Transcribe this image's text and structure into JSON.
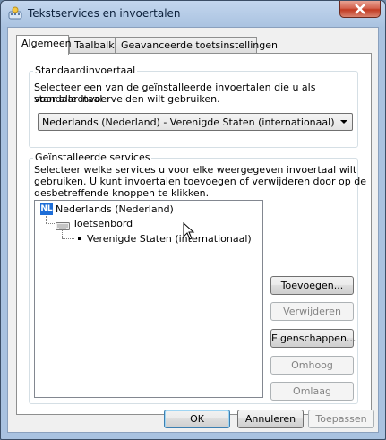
{
  "window": {
    "title": "Tekstservices en invoertalen"
  },
  "tabs": [
    {
      "label": "Algemeen",
      "active": true
    },
    {
      "label": "Taalbalk",
      "active": false
    },
    {
      "label": "Geavanceerde toetsinstellingen",
      "active": false
    }
  ],
  "default_language": {
    "group_label": "Standaardinvoertaal",
    "description_line1": "Selecteer een van de geïnstalleerde invoertalen die u als standaardtaal",
    "description_line2": "voor alle invoervelden wilt gebruiken.",
    "selected": "Nederlands (Nederland) - Verenigde Staten (internationaal)"
  },
  "installed_services": {
    "group_label": "Geïnstalleerde services",
    "description_line1": "Selecteer welke services u voor elke weergegeven invoertaal wilt",
    "description_line2": "gebruiken. U kunt invoertalen toevoegen of verwijderen door op de",
    "description_line3": "desbetreffende knoppen te klikken.",
    "tree": {
      "language_badge": "NL",
      "language": "Nederlands (Nederland)",
      "category": "Toetsenbord",
      "layout": "Verenigde Staten (internationaal)"
    }
  },
  "side_buttons": {
    "add": "Toevoegen...",
    "remove": "Verwijderen",
    "properties": "Eigenschappen...",
    "up": "Omhoog",
    "down": "Omlaag"
  },
  "footer": {
    "ok": "OK",
    "cancel": "Annuleren",
    "apply": "Toepassen"
  }
}
